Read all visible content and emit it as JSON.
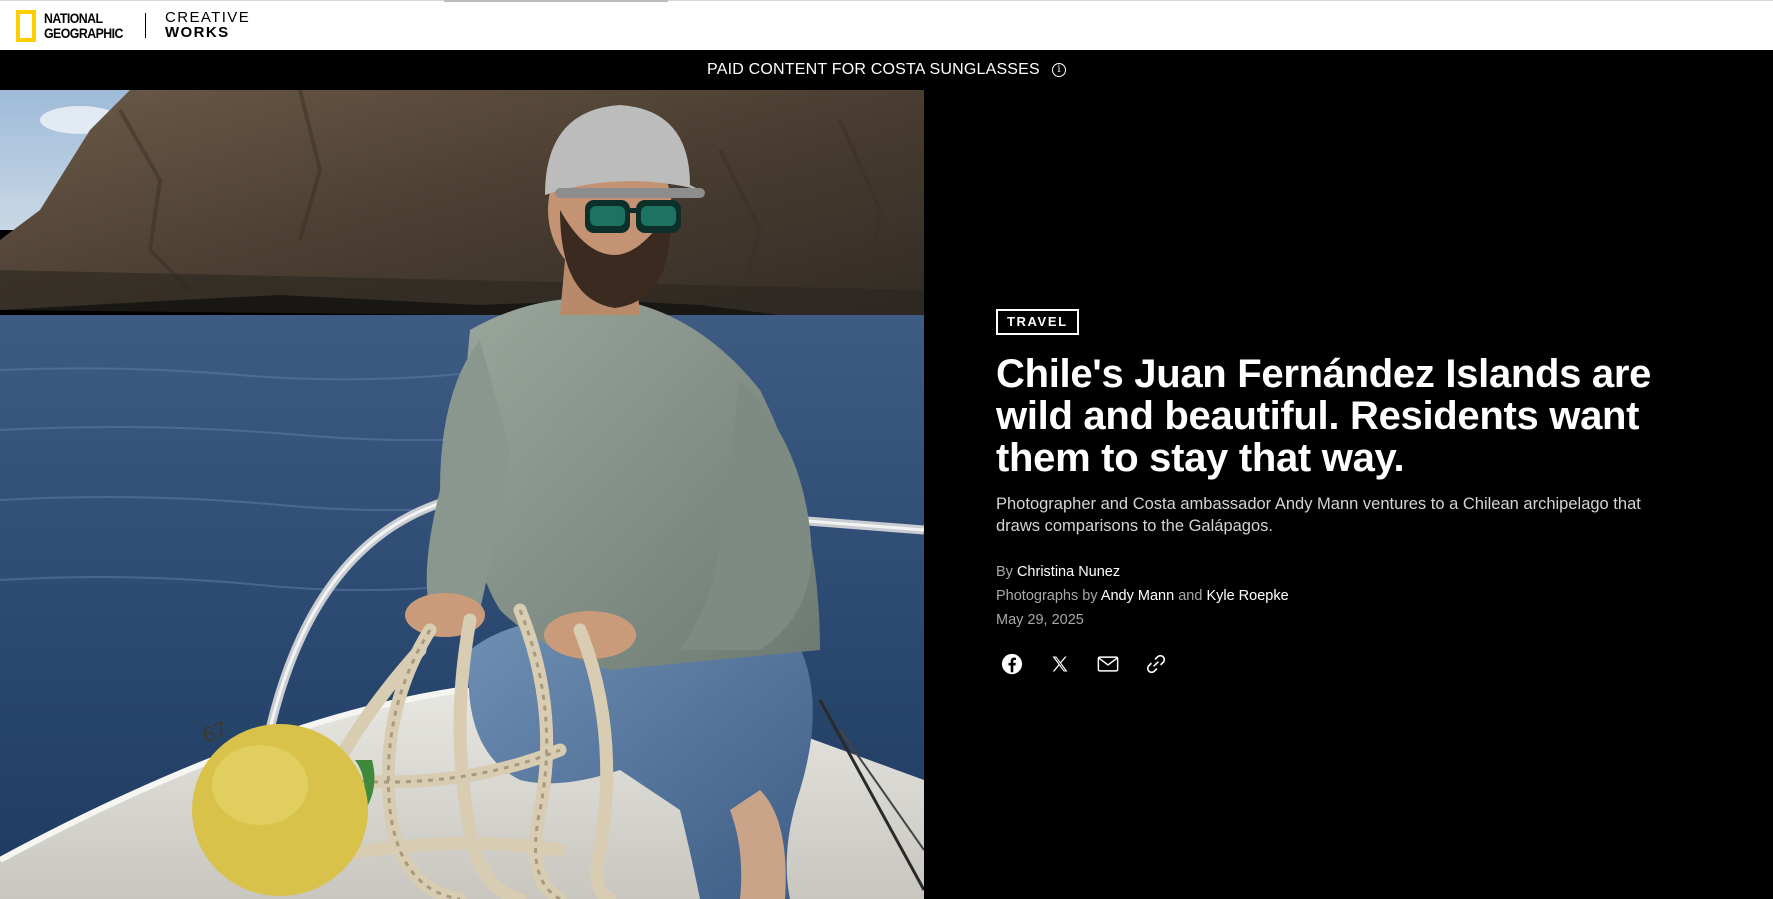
{
  "brand": {
    "logo_line1": "NATIONAL",
    "logo_line2": "GEOGRAPHIC",
    "sub_line1": "CREATIVE",
    "sub_line2": "WORKS",
    "logo_yellow": "#ffce00"
  },
  "sponsor": {
    "label": "PAID CONTENT FOR COSTA SUNGLASSES",
    "info_icon": "info-icon"
  },
  "hero": {
    "image": "man-kneeling-on-boat-bow-with-rope-photo"
  },
  "article": {
    "category": "TRAVEL",
    "headline": "Chile's Juan Fernández Islands are wild and beautiful. Residents want them to stay that way.",
    "dek": "Photographer and Costa ambassador Andy Mann ventures to a Chilean archipelago that draws comparisons to the Galápagos.",
    "byline_prefix": "By",
    "author": "Christina Nunez",
    "photos_prefix": "Photographs by",
    "photographer_1": "Andy Mann",
    "photos_joiner": "and",
    "photographer_2": "Kyle Roepke",
    "date": "May 29, 2025"
  },
  "share": {
    "icons": [
      "facebook-icon",
      "x-icon",
      "email-icon",
      "link-icon"
    ]
  }
}
